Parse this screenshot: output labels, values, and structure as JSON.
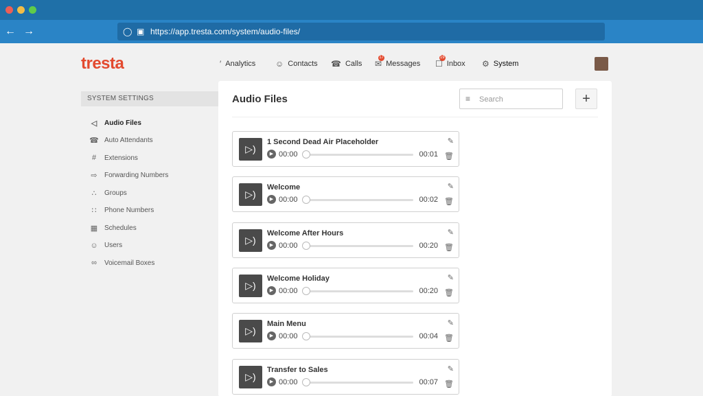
{
  "browser": {
    "url": "https://app.tresta.com/system/audio-files/",
    "dots": [
      "#ec5f56",
      "#f3bd46",
      "#5fcc4a"
    ]
  },
  "logo": "tresta",
  "nav": [
    {
      "label": "Analytics",
      "icon": "chart-icon",
      "glyph": "′"
    },
    {
      "label": "Contacts",
      "icon": "person-icon",
      "glyph": "☺"
    },
    {
      "label": "Calls",
      "icon": "phone-box-icon",
      "glyph": "☎"
    },
    {
      "label": "Messages",
      "icon": "message-icon",
      "glyph": "✉",
      "badge": "17"
    },
    {
      "label": "Inbox",
      "icon": "inbox-icon",
      "glyph": "☐",
      "badge": "19"
    },
    {
      "label": "System",
      "icon": "gear-icon",
      "glyph": "⚙"
    }
  ],
  "sidebar": {
    "title": "SYSTEM SETTINGS",
    "items": [
      {
        "label": "Audio Files",
        "icon": "speaker-icon",
        "glyph": "◁",
        "active": true
      },
      {
        "label": "Auto Attendants",
        "icon": "phone-menu-icon",
        "glyph": "☎"
      },
      {
        "label": "Extensions",
        "icon": "hash-icon",
        "glyph": "#"
      },
      {
        "label": "Forwarding Numbers",
        "icon": "forward-arrow-icon",
        "glyph": "⇨"
      },
      {
        "label": "Groups",
        "icon": "group-icon",
        "glyph": "∴"
      },
      {
        "label": "Phone Numbers",
        "icon": "keypad-icon",
        "glyph": "∷"
      },
      {
        "label": "Schedules",
        "icon": "calendar-icon",
        "glyph": "▦"
      },
      {
        "label": "Users",
        "icon": "user-icon",
        "glyph": "☺"
      },
      {
        "label": "Voicemail Boxes",
        "icon": "voicemail-icon",
        "glyph": "∞"
      }
    ]
  },
  "main": {
    "title": "Audio Files",
    "search_placeholder": "Search",
    "add_label": "+",
    "files": [
      {
        "name": "1 Second Dead Air Placeholder",
        "current": "00:00",
        "duration": "00:01"
      },
      {
        "name": "Welcome",
        "current": "00:00",
        "duration": "00:02"
      },
      {
        "name": "Welcome After Hours",
        "current": "00:00",
        "duration": "00:20"
      },
      {
        "name": "Welcome Holiday",
        "current": "00:00",
        "duration": "00:20"
      },
      {
        "name": "Main Menu",
        "current": "00:00",
        "duration": "00:04"
      },
      {
        "name": "Transfer to Sales",
        "current": "00:00",
        "duration": "00:07"
      }
    ]
  }
}
